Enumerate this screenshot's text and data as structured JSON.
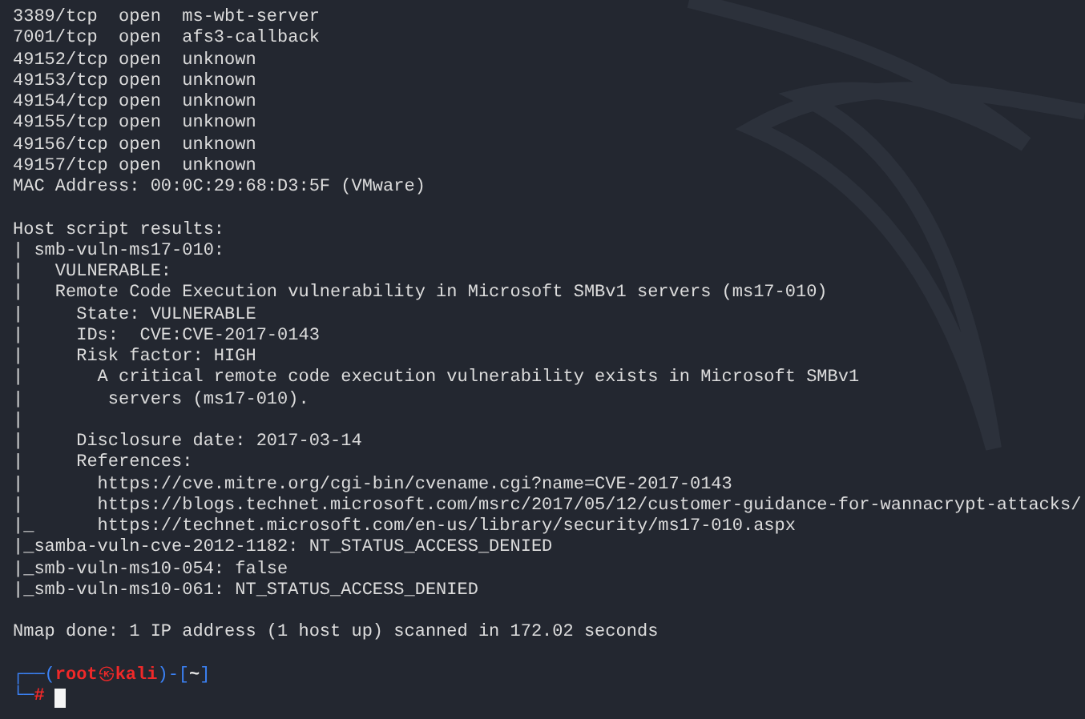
{
  "terminal": {
    "lines": [
      {
        "kind": "text",
        "text": "3389/tcp  open  ms-wbt-server"
      },
      {
        "kind": "text",
        "text": "7001/tcp  open  afs3-callback"
      },
      {
        "kind": "text",
        "text": "49152/tcp open  unknown"
      },
      {
        "kind": "text",
        "text": "49153/tcp open  unknown"
      },
      {
        "kind": "text",
        "text": "49154/tcp open  unknown"
      },
      {
        "kind": "text",
        "text": "49155/tcp open  unknown"
      },
      {
        "kind": "text",
        "text": "49156/tcp open  unknown"
      },
      {
        "kind": "text",
        "text": "49157/tcp open  unknown"
      },
      {
        "kind": "text",
        "text": "MAC Address: 00:0C:29:68:D3:5F (VMware)"
      },
      {
        "kind": "blank"
      },
      {
        "kind": "text",
        "text": "Host script results:"
      },
      {
        "kind": "text",
        "text": "| smb-vuln-ms17-010:"
      },
      {
        "kind": "text",
        "text": "|   VULNERABLE:"
      },
      {
        "kind": "text",
        "text": "|   Remote Code Execution vulnerability in Microsoft SMBv1 servers (ms17-010)"
      },
      {
        "kind": "text",
        "text": "|     State: VULNERABLE"
      },
      {
        "kind": "text",
        "text": "|     IDs:  CVE:CVE-2017-0143"
      },
      {
        "kind": "text",
        "text": "|     Risk factor: HIGH"
      },
      {
        "kind": "text",
        "text": "|       A critical remote code execution vulnerability exists in Microsoft SMBv1"
      },
      {
        "kind": "text",
        "text": "|        servers (ms17-010)."
      },
      {
        "kind": "text",
        "text": "|"
      },
      {
        "kind": "text",
        "text": "|     Disclosure date: 2017-03-14"
      },
      {
        "kind": "text",
        "text": "|     References:"
      },
      {
        "kind": "text",
        "text": "|       https://cve.mitre.org/cgi-bin/cvename.cgi?name=CVE-2017-0143"
      },
      {
        "kind": "text",
        "text": "|       https://blogs.technet.microsoft.com/msrc/2017/05/12/customer-guidance-for-wannacrypt-attacks/"
      },
      {
        "kind": "text",
        "text": "|_      https://technet.microsoft.com/en-us/library/security/ms17-010.aspx"
      },
      {
        "kind": "text",
        "text": "|_samba-vuln-cve-2012-1182: NT_STATUS_ACCESS_DENIED"
      },
      {
        "kind": "text",
        "text": "|_smb-vuln-ms10-054: false"
      },
      {
        "kind": "text",
        "text": "|_smb-vuln-ms10-061: NT_STATUS_ACCESS_DENIED"
      },
      {
        "kind": "blank"
      },
      {
        "kind": "text",
        "text": "Nmap done: 1 IP address (1 host up) scanned in 172.02 seconds"
      },
      {
        "kind": "blank"
      }
    ],
    "prompt": {
      "corner_top": "┌──(",
      "user": "root",
      "at": "㉿",
      "host": "kali",
      "separator": ")-[",
      "cwd": "~",
      "close": "]",
      "corner_bottom": "└─",
      "hash": "#"
    }
  }
}
